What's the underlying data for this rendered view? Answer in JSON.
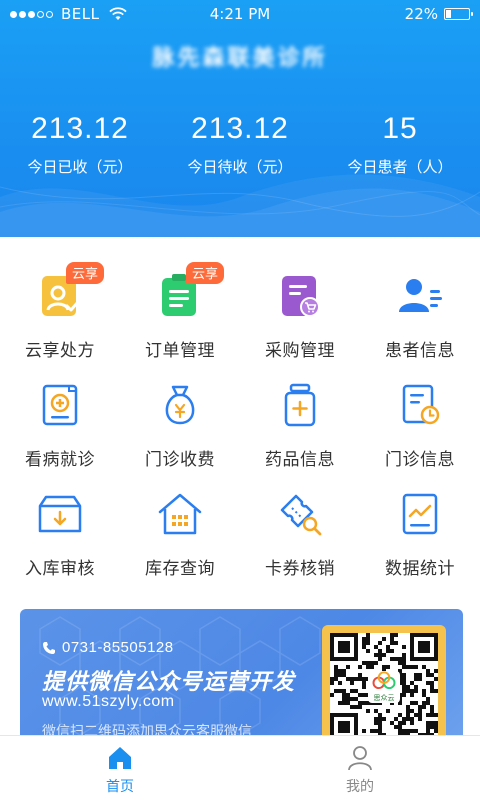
{
  "status_bar": {
    "carrier": "BELL",
    "time": "4:21 PM",
    "battery_percent": "22%",
    "battery_level": 0.22,
    "signal_bars_filled": 3,
    "signal_bars_total": 5
  },
  "header": {
    "clinic_name": "脉先森联美诊所",
    "stats": [
      {
        "value": "213.12",
        "label": "今日已收（元）"
      },
      {
        "value": "213.12",
        "label": "今日待收（元）"
      },
      {
        "value": "15",
        "label": "今日患者（人）"
      }
    ]
  },
  "menu": [
    {
      "label": "云享处方",
      "icon": "prescription-icon",
      "badge": "云享"
    },
    {
      "label": "订单管理",
      "icon": "order-icon",
      "badge": "云享"
    },
    {
      "label": "采购管理",
      "icon": "purchase-icon",
      "badge": ""
    },
    {
      "label": "患者信息",
      "icon": "patient-icon",
      "badge": ""
    },
    {
      "label": "看病就诊",
      "icon": "consult-icon",
      "badge": ""
    },
    {
      "label": "门诊收费",
      "icon": "charge-icon",
      "badge": ""
    },
    {
      "label": "药品信息",
      "icon": "medicine-icon",
      "badge": ""
    },
    {
      "label": "门诊信息",
      "icon": "outpatient-icon",
      "badge": ""
    },
    {
      "label": "入库审核",
      "icon": "inbound-icon",
      "badge": ""
    },
    {
      "label": "库存查询",
      "icon": "inventory-icon",
      "badge": ""
    },
    {
      "label": "卡券核销",
      "icon": "coupon-icon",
      "badge": ""
    },
    {
      "label": "数据统计",
      "icon": "statistics-icon",
      "badge": ""
    }
  ],
  "banner": {
    "phone": "0731-85505128",
    "headline": "提供微信公众号运营开发",
    "url": "www.51szyly.com",
    "subtext": "微信扫二维码添加思众云客服微信",
    "qr_logo_text": "思众云"
  },
  "tabbar": [
    {
      "label": "首页",
      "icon": "home-icon",
      "active": true
    },
    {
      "label": "我的",
      "icon": "profile-icon",
      "active": false
    }
  ],
  "colors": {
    "primary": "#1a8ff0",
    "badge": "#ff6a3a",
    "qr_frame": "#f5c24d"
  }
}
